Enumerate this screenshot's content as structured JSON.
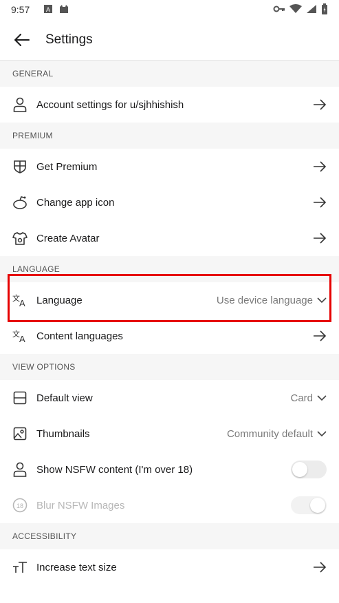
{
  "status": {
    "time": "9:57"
  },
  "header": {
    "title": "Settings"
  },
  "sections": {
    "general": "GENERAL",
    "premium": "PREMIUM",
    "language": "LANGUAGE",
    "view_options": "VIEW OPTIONS",
    "accessibility": "ACCESSIBILITY"
  },
  "rows": {
    "account": "Account settings for u/sjhhishish",
    "get_premium": "Get Premium",
    "change_icon": "Change app icon",
    "create_avatar": "Create Avatar",
    "language": "Language",
    "language_value": "Use device language",
    "content_languages": "Content languages",
    "default_view": "Default view",
    "default_view_value": "Card",
    "thumbnails": "Thumbnails",
    "thumbnails_value": "Community default",
    "show_nsfw": "Show NSFW content (I'm over 18)",
    "blur_nsfw": "Blur NSFW Images",
    "increase_text": "Increase text size"
  },
  "icons": {
    "back": "arrow-left-icon",
    "account": "user-icon",
    "premium": "shield-icon",
    "app_icon": "reddit-alien-icon",
    "avatar": "avatar-icon",
    "language": "translate-icon",
    "content_language": "translate-icon",
    "default_view": "view-card-icon",
    "thumbnails": "image-icon",
    "nsfw": "user-icon",
    "blur_nsfw": "18-badge-icon",
    "text_size": "text-size-icon"
  },
  "toggles": {
    "show_nsfw": false,
    "blur_nsfw": true
  },
  "colors": {
    "highlight": "#e60000"
  }
}
